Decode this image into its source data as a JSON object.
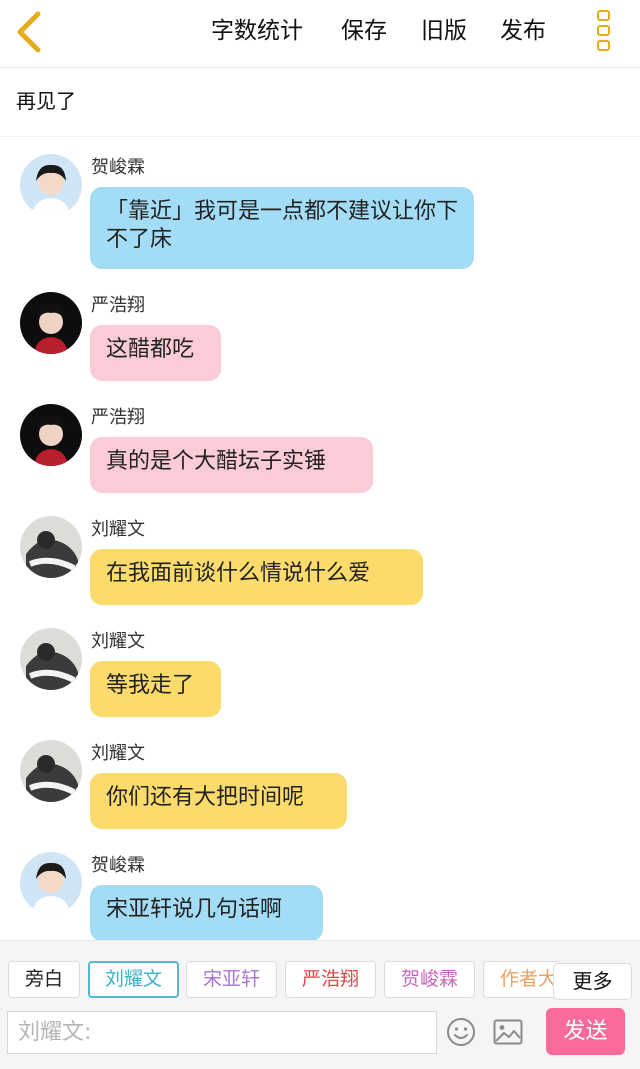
{
  "header": {
    "word_count_label": "字数统计",
    "save_label": "保存",
    "old_version_label": "旧版",
    "publish_label": "发布"
  },
  "story_title": "再见了",
  "messages": [
    {
      "name": "贺峻霖",
      "text": "「靠近」我可是一点都不建议让你下不了床",
      "color": "#a3dcf6"
    },
    {
      "name": "严浩翔",
      "text": "这醋都吃",
      "color": "#fbcbd8"
    },
    {
      "name": "严浩翔",
      "text": "真的是个大醋坛子实锤",
      "color": "#fbcbd8"
    },
    {
      "name": "刘耀文",
      "text": "在我面前谈什么情说什么爱",
      "color": "#fadb6b"
    },
    {
      "name": "刘耀文",
      "text": "等我走了",
      "color": "#fadb6b"
    },
    {
      "name": "刘耀文",
      "text": "你们还有大把时间呢",
      "color": "#fadb6b"
    },
    {
      "name": "贺峻霖",
      "text": "宋亚轩说几句话啊",
      "color": "#a3dcf6"
    }
  ],
  "role_chips": [
    {
      "label": "旁白",
      "color": "#222222"
    },
    {
      "label": "刘耀文",
      "color": "#3bb3c4"
    },
    {
      "label": "宋亚轩",
      "color": "#a877d6"
    },
    {
      "label": "严浩翔",
      "color": "#e04848"
    },
    {
      "label": "贺峻霖",
      "color": "#c964b8"
    },
    {
      "label": "作者大",
      "color": "#f0a060"
    }
  ],
  "more_label": "更多",
  "input": {
    "placeholder": "刘耀文:"
  },
  "send_label": "发送",
  "colors": {
    "accent": "#e6ad19",
    "send": "#fa6a9b",
    "active_chip_border": "#52b8d4"
  }
}
